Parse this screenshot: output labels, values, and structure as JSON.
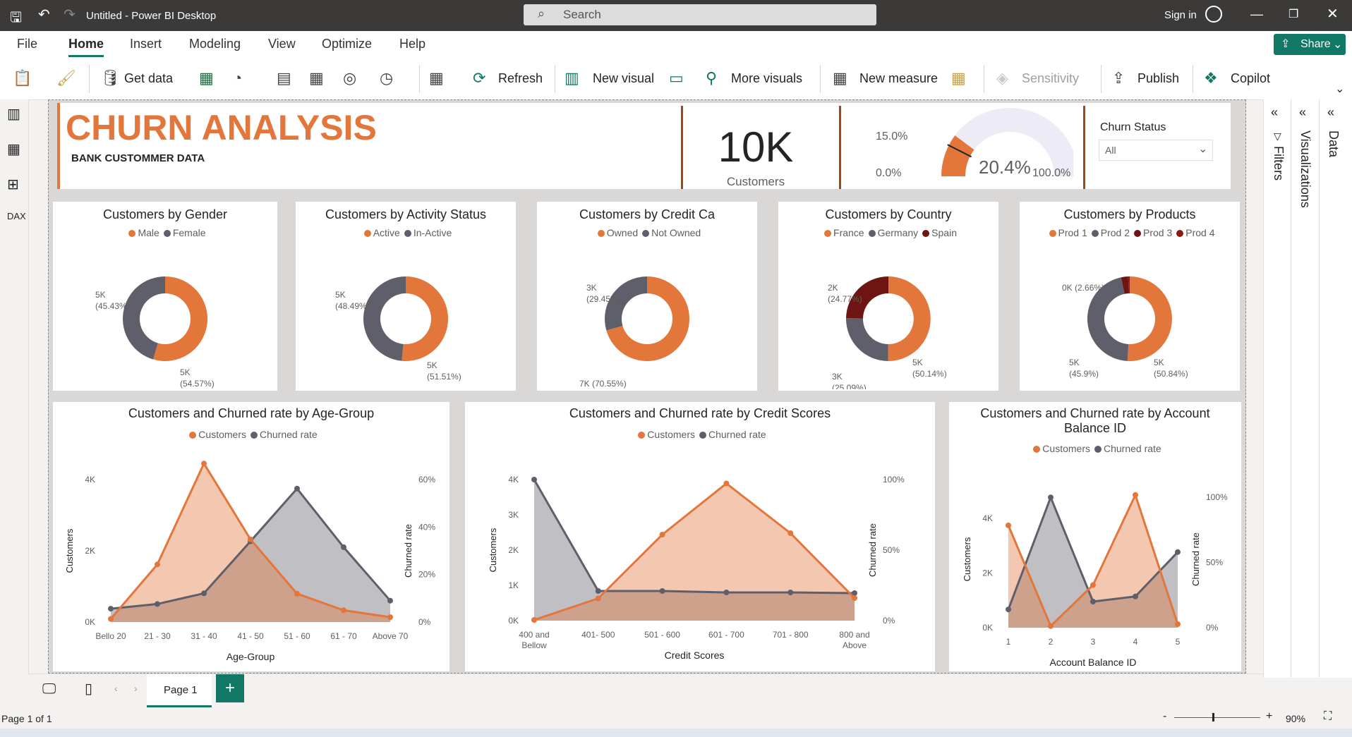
{
  "window": {
    "title": "Untitled - Power BI Desktop",
    "search_placeholder": "Search",
    "sign_in": "Sign in",
    "share": "Share"
  },
  "menu": [
    "File",
    "Home",
    "Insert",
    "Modeling",
    "View",
    "Optimize",
    "Help"
  ],
  "ribbon": {
    "get_data": "Get data",
    "refresh": "Refresh",
    "new_visual": "New visual",
    "more_visuals": "More visuals",
    "new_measure": "New measure",
    "sensitivity": "Sensitivity",
    "publish": "Publish",
    "copilot": "Copilot"
  },
  "header": {
    "title": "CHURN ANALYSIS",
    "subtitle": "BANK CUSTOMMER DATA",
    "kpi_value": "10K",
    "kpi_label": "Customers"
  },
  "gauge": {
    "min_label": "0.0%",
    "max_label": "100.0%",
    "target_label": "15.0%",
    "value_label": "20.4%",
    "value": 0.204,
    "target": 0.15
  },
  "slicer": {
    "title": "Churn Status",
    "selected": "All"
  },
  "colors": {
    "orange": "#E3763A",
    "gray": "#5F5F6B",
    "darkred": "#6E1412",
    "maroon": "#8B1A10"
  },
  "donuts": [
    {
      "title": "Customers by Gender",
      "legend": [
        "Male",
        "Female"
      ],
      "colors": [
        "#E3763A",
        "#5F5F6B"
      ],
      "values": [
        54.57,
        45.43
      ],
      "labels": [
        [
          "5K",
          "(54.57%)"
        ],
        [
          "5K",
          "(45.43%)"
        ]
      ]
    },
    {
      "title": "Customers by Activity Status",
      "legend": [
        "Active",
        "In-Active"
      ],
      "colors": [
        "#E3763A",
        "#5F5F6B"
      ],
      "values": [
        51.51,
        48.49
      ],
      "labels": [
        [
          "5K",
          "(51.51%)"
        ],
        [
          "5K",
          "(48.49%)"
        ]
      ]
    },
    {
      "title": "Customers by Credit Ca",
      "legend": [
        "Owned",
        "Not Owned"
      ],
      "colors": [
        "#E3763A",
        "#5F5F6B"
      ],
      "values": [
        70.55,
        29.45
      ],
      "labels": [
        [
          "7K (70.55%)"
        ],
        [
          "3K",
          "(29.45%)"
        ]
      ]
    },
    {
      "title": "Customers by Country",
      "legend": [
        "France",
        "Germany",
        "Spain"
      ],
      "colors": [
        "#E3763A",
        "#5F5F6B",
        "#6E1412"
      ],
      "values": [
        50.14,
        25.09,
        24.77
      ],
      "labels": [
        [
          "5K",
          "(50.14%)"
        ],
        [
          "3K",
          "(25.09%)"
        ],
        [
          "2K",
          "(24.77%)"
        ]
      ]
    },
    {
      "title": "Customers by Products",
      "legend": [
        "Prod 1",
        "Prod 2",
        "Prod 3",
        "Prod 4"
      ],
      "colors": [
        "#E3763A",
        "#5F5F6B",
        "#6E1412",
        "#8B1A10"
      ],
      "values": [
        50.84,
        45.9,
        2.66,
        0.6
      ],
      "labels": [
        [
          "5K",
          "(50.84%)"
        ],
        [
          "5K",
          "(45.9%)"
        ],
        [
          "0K (2.66%)"
        ]
      ]
    }
  ],
  "chart_data": [
    {
      "type": "area",
      "title": "Customers and Churned rate by Age-Group",
      "xlabel": "Age-Group",
      "ylabel": "Customers",
      "y2label": "Churned rate",
      "categories": [
        "Bello 20",
        "21 - 30",
        "31 - 40",
        "41 - 50",
        "51 - 60",
        "61 - 70",
        "Above 70"
      ],
      "ylim": [
        0,
        4000
      ],
      "y2lim": [
        0,
        0.6
      ],
      "yticks": [
        "0K",
        "2K",
        "4K"
      ],
      "y2ticks": [
        "0%",
        "20%",
        "40%",
        "60%"
      ],
      "series": [
        {
          "name": "Customers",
          "axis": "left",
          "values": [
            89,
            1618,
            4451,
            2320,
            797,
            331,
            137
          ]
        },
        {
          "name": "Churned rate",
          "axis": "right",
          "values": [
            0.056,
            0.076,
            0.121,
            0.34,
            0.562,
            0.315,
            0.09
          ]
        }
      ]
    },
    {
      "type": "area",
      "title": "Customers and Churned rate by Credit Scores",
      "xlabel": "Credit Scores",
      "ylabel": "Customers",
      "y2label": "Churned rate",
      "categories": [
        "400 and Bellow",
        "401- 500",
        "501 - 600",
        "601 - 700",
        "701 - 800",
        "800 and Above"
      ],
      "ylim": [
        0,
        4000
      ],
      "y2lim": [
        0,
        1
      ],
      "yticks": [
        "0K",
        "1K",
        "2K",
        "3K",
        "4K"
      ],
      "y2ticks": [
        "0%",
        "50%",
        "100%"
      ],
      "series": [
        {
          "name": "Customers",
          "axis": "left",
          "values": [
            20,
            630,
            2440,
            3890,
            2480,
            640
          ]
        },
        {
          "name": "Churned rate",
          "axis": "right",
          "values": [
            1.0,
            0.21,
            0.21,
            0.2,
            0.2,
            0.195
          ]
        }
      ]
    },
    {
      "type": "area",
      "title": "Customers and Churned rate by Account Balance ID",
      "xlabel": "Account Balance ID",
      "ylabel": "Customers",
      "y2label": "Churned rate",
      "categories": [
        "1",
        "2",
        "3",
        "4",
        "5"
      ],
      "ylim": [
        0,
        5000
      ],
      "y2lim": [
        0,
        1.05
      ],
      "yticks": [
        "0K",
        "2K",
        "4K"
      ],
      "y2ticks": [
        "0%",
        "50%",
        "100%"
      ],
      "series": [
        {
          "name": "Customers",
          "axis": "left",
          "values": [
            3740,
            60,
            1560,
            4850,
            130
          ]
        },
        {
          "name": "Churned rate",
          "axis": "right",
          "values": [
            0.14,
            1.0,
            0.2,
            0.24,
            0.58
          ]
        }
      ]
    }
  ],
  "right_panes": [
    "Filters",
    "Visualizations",
    "Data"
  ],
  "pages": {
    "tab": "Page 1",
    "status": "Page 1 of 1",
    "zoom": "90%"
  }
}
